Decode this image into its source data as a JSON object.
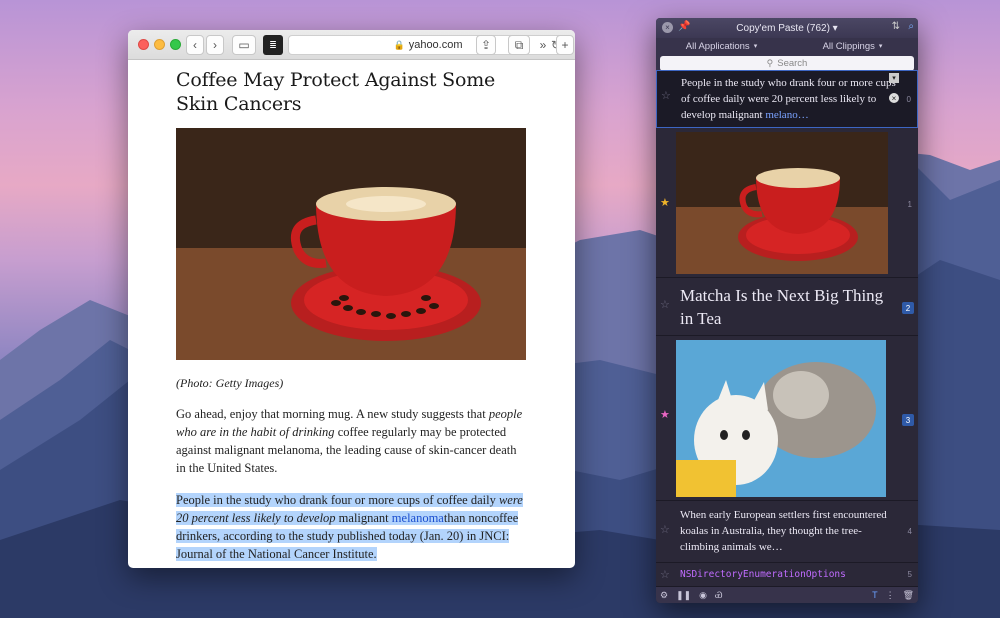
{
  "safari": {
    "url": "yahoo.com",
    "article": {
      "title": "Coffee May Protect Against Some Skin Cancers",
      "caption": "(Photo: Getty Images)",
      "para1_a": "Go ahead, enjoy that morning mug. A new study suggests that ",
      "para1_italic": "people who are in the habit of drinking",
      "para1_b": " coffee regularly may be protected against malignant melanoma, the leading cause of skin-cancer death in the United States.",
      "para2_a": "People in the study who drank four or more cups of coffee daily ",
      "para2_italic": "were 20 percent less likely to develop",
      "para2_b": " malignant ",
      "para2_link": "melanoma",
      "para2_c": "than noncoffee drinkers, according to the study published today (Jan. 20) in JNCI: Journal of the National Cancer Institute."
    }
  },
  "copyem": {
    "title": "Copy'em Paste (762) ▾",
    "tab_left": "All Applications",
    "tab_right": "All Clippings",
    "search_placeholder": "Search",
    "clips": [
      {
        "text_a": "People in the study who drank four or more cups of coffee daily were 20 percent less likely to develop malignant ",
        "text_link": "melano…",
        "num": "0"
      },
      {
        "num": "1"
      },
      {
        "text": "Matcha Is the Next Big Thing in Tea",
        "badge": "2"
      },
      {
        "badge": "3"
      },
      {
        "text": "When early European settlers first encountered koalas in Australia, they thought the tree-climbing animals we…",
        "num": "4"
      },
      {
        "text": "NSDirectoryEnumerationOptions",
        "num": "5"
      }
    ],
    "colors": {
      "accent": "#3d66c4",
      "panel_bg": "#2b2838",
      "star_gold": "#f0b429",
      "star_pink": "#e866c3"
    }
  }
}
